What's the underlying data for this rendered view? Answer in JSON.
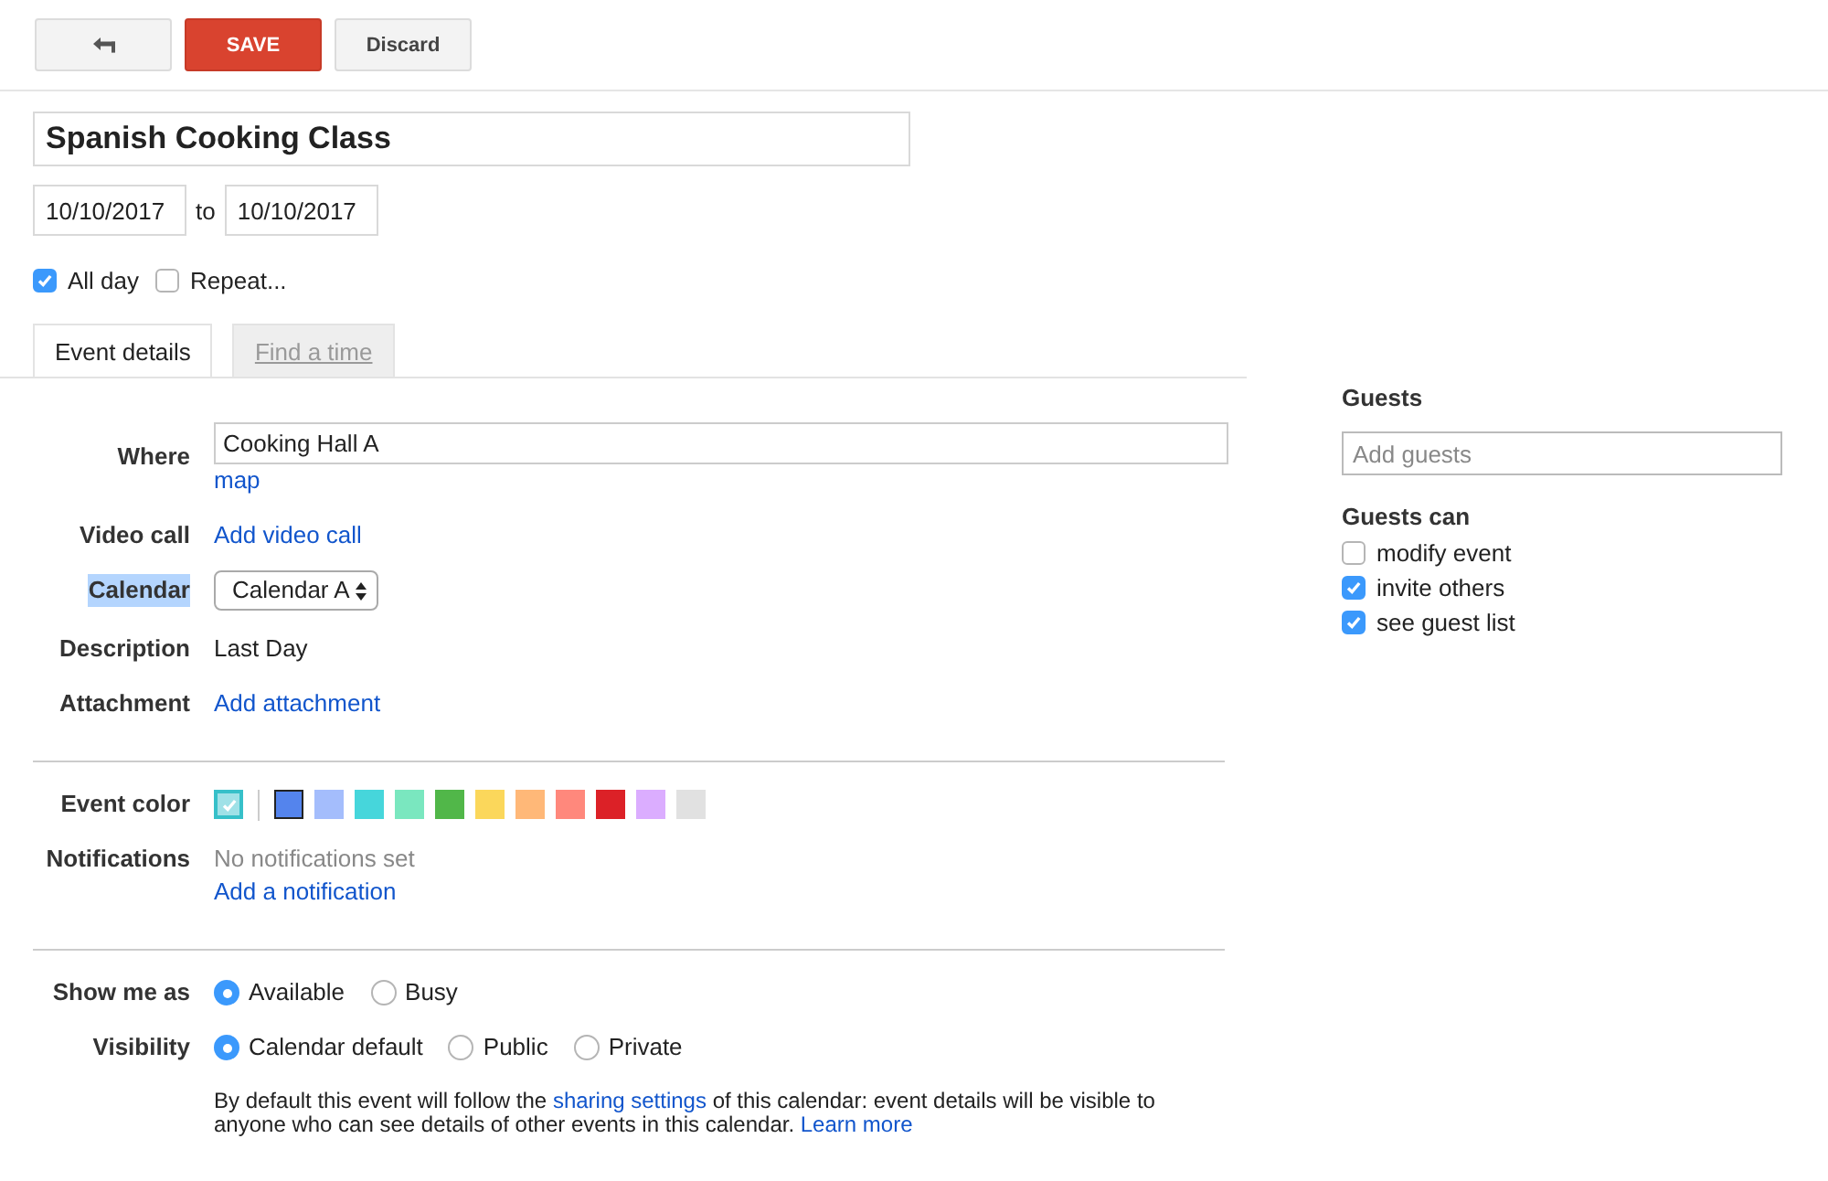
{
  "toolbar": {
    "buttons": [
      {
        "kind": "back"
      },
      {
        "kind": "primary",
        "label": "SAVE"
      },
      {
        "kind": "default",
        "label": "Discard"
      }
    ]
  },
  "title": {
    "value": "Spanish Cooking Class"
  },
  "dates": {
    "start": "10/10/2017",
    "separator": "to",
    "end": "10/10/2017"
  },
  "options": [
    {
      "label": "All day",
      "checked": true
    },
    {
      "label": "Repeat...",
      "checked": false
    }
  ],
  "tabs": [
    {
      "label": "Event details",
      "selected": true
    },
    {
      "label": "Find a time",
      "selected": false
    }
  ],
  "sections": [
    {
      "rows": [
        {
          "label": "Where",
          "highlighted": false,
          "kind": "input",
          "value": "Cooking Hall A",
          "link": "map"
        },
        {
          "label": "Video call",
          "highlighted": false,
          "kind": "link",
          "link": "Add video call"
        },
        {
          "label": "Calendar",
          "highlighted": true,
          "kind": "select",
          "value": "Calendar A"
        },
        {
          "label": "Description",
          "highlighted": false,
          "kind": "text",
          "value": "Last Day"
        },
        {
          "label": "Attachment",
          "highlighted": false,
          "kind": "link",
          "link": "Add attachment"
        }
      ]
    },
    {
      "rows": [
        {
          "label": "Event color",
          "highlighted": false,
          "kind": "colors",
          "default": {
            "color": "#9fe1e7",
            "selected": true
          },
          "colors": [
            {
              "color": "#5484ed",
              "selected": false,
              "focused": true
            },
            {
              "color": "#a4bdfc",
              "selected": false,
              "focused": false
            },
            {
              "color": "#46d6db",
              "selected": false,
              "focused": false
            },
            {
              "color": "#7ae7bf",
              "selected": false,
              "focused": false
            },
            {
              "color": "#51b749",
              "selected": false,
              "focused": false
            },
            {
              "color": "#fbd75b",
              "selected": false,
              "focused": false
            },
            {
              "color": "#ffb878",
              "selected": false,
              "focused": false
            },
            {
              "color": "#ff887c",
              "selected": false,
              "focused": false
            },
            {
              "color": "#dc2127",
              "selected": false,
              "focused": false
            },
            {
              "color": "#dbadff",
              "selected": false,
              "focused": false
            },
            {
              "color": "#e1e1e1",
              "selected": false,
              "focused": false
            }
          ]
        },
        {
          "label": "Notifications",
          "highlighted": false,
          "kind": "notifications",
          "note": "No notifications set",
          "link": "Add a notification"
        }
      ]
    },
    {
      "rows": [
        {
          "label": "Show me as",
          "highlighted": false,
          "kind": "radios",
          "options": [
            {
              "label": "Available",
              "selected": true
            },
            {
              "label": "Busy",
              "selected": false
            }
          ]
        },
        {
          "label": "Visibility",
          "highlighted": false,
          "kind": "radios",
          "options": [
            {
              "label": "Calendar default",
              "selected": true
            },
            {
              "label": "Public",
              "selected": false
            },
            {
              "label": "Private",
              "selected": false
            }
          ],
          "note": [
            {
              "kind": "text",
              "text": "By default this event will follow the "
            },
            {
              "kind": "link",
              "text": "sharing settings"
            },
            {
              "kind": "text",
              "text": " of this calendar: event details will be visible to anyone who can see details of other events in this calendar.  "
            },
            {
              "kind": "link",
              "text": "Learn more"
            }
          ]
        }
      ]
    }
  ],
  "guests": {
    "title": "Guests",
    "placeholder": "Add guests",
    "permissions_title": "Guests can",
    "permissions": [
      {
        "label": "modify event",
        "checked": false
      },
      {
        "label": "invite others",
        "checked": true
      },
      {
        "label": "see guest list",
        "checked": true
      }
    ]
  }
}
